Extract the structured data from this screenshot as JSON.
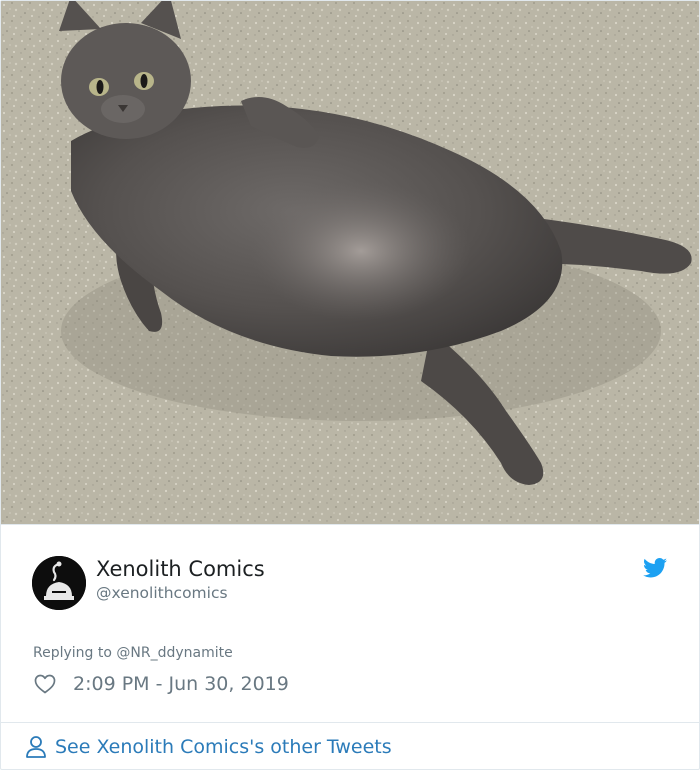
{
  "tweet": {
    "author": {
      "display_name": "Xenolith Comics",
      "handle": "@xenolithcomics"
    },
    "reply_to_text": "Replying to @NR_ddynamite",
    "timestamp": "2:09 PM - Jun 30, 2019",
    "footer_link_label": "See Xenolith Comics's other Tweets"
  },
  "icons": {
    "brand": "twitter-bird-icon",
    "like": "heart-outline-icon",
    "profile": "person-outline-icon"
  },
  "colors": {
    "twitter_blue": "#1da1f2",
    "link_blue": "#2b7bb9",
    "muted_text": "#697882",
    "border": "#e1e8ed"
  }
}
